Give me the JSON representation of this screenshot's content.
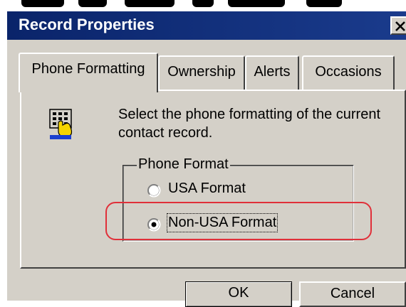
{
  "window": {
    "title": "Record Properties",
    "close_label": "×",
    "titlebar_color": "#0a246a"
  },
  "tabs": [
    {
      "label": "Phone Formatting",
      "active": true
    },
    {
      "label": "Ownership",
      "active": false
    },
    {
      "label": "Alerts",
      "active": false
    },
    {
      "label": "Occasions",
      "active": false
    }
  ],
  "panel": {
    "description": "Select the phone formatting of the current contact record.",
    "icon": "phone-keypad-hand-icon",
    "group": {
      "legend": "Phone Format",
      "options": [
        {
          "label": "USA Format",
          "selected": false
        },
        {
          "label": "Non-USA Format",
          "selected": true
        }
      ]
    }
  },
  "buttons": {
    "ok": "OK",
    "cancel": "Cancel"
  },
  "annotation": {
    "color": "#e0303a"
  }
}
